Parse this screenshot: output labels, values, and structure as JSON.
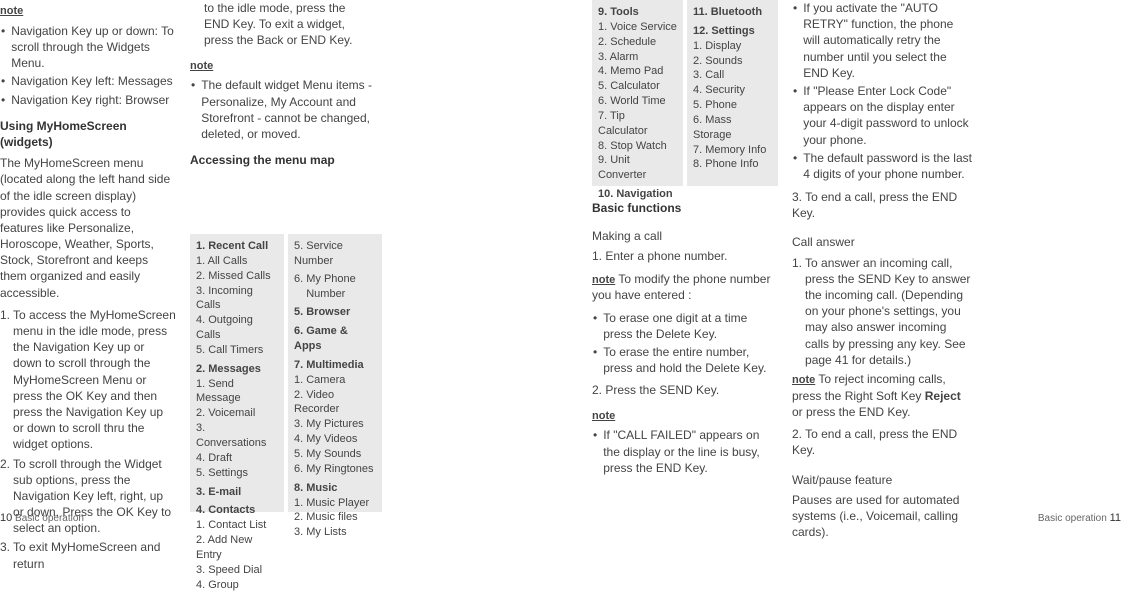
{
  "col1": {
    "note": "note",
    "b1": "Navigation Key up or down: To scroll through the Widgets Menu.",
    "b2": "Navigation Key left: Messages",
    "b3": "Navigation Key right: Browser",
    "h1": "Using MyHomeScreen (widgets)",
    "p1": "The MyHomeScreen menu (located along the left hand side of the idle screen display) provides quick access to features like Personalize, Horoscope, Weather, Sports, Stock, Storefront and keeps them organized and easily accessible.",
    "n1": "1.",
    "n1t": "To access the MyHomeScreen menu in the idle mode, press the Navigation Key up or down to scroll through the MyHomeScreen Menu or press the OK Key and then press the Navigation Key up or down to scroll thru the widget options.",
    "n2": "2.",
    "n2t": "To scroll through the Widget sub options, press the Navigation Key left, right, up or down. Press the OK Key to select an option.",
    "n3": "3.",
    "n3t": "To exit MyHomeScreen and return",
    "footer_num": "10",
    "footer_text": "Basic operation"
  },
  "col2": {
    "cont": "to the idle mode, press the END Key. To exit a widget, press the Back or END Key.",
    "note": "note",
    "b1": "The default widget Menu items - Personalize, My Account and Storefront - cannot be changed, deleted, or moved.",
    "h1": "Accessing the menu map"
  },
  "menu_left": {
    "t1": "1. Recent Call",
    "i1_1": "1.   All Calls",
    "i1_2": "2. Missed Calls",
    "i1_3": "3. Incoming Calls",
    "i1_4": "4. Outgoing Calls",
    "i1_5": "5. Call Timers",
    "t2": "2. Messages",
    "i2_1": "1.   Send Message",
    "i2_2": "2. Voicemail",
    "i2_3": "3. Conversations",
    "i2_4": "4. Draft",
    "i2_5": "5.   Settings",
    "t3": "3. E-mail",
    "t4": "4. Contacts",
    "i4_1": "1.   Contact List",
    "i4_2": "2. Add New Entry",
    "i4_3": "3. Speed Dial",
    "i4_4": "4. Group"
  },
  "menu_right": {
    "i5": "5. Service Number",
    "i6": "6. My Phone Number",
    "t5": "5. Browser",
    "t6": "6. Game & Apps",
    "t7": "7. Multimedia",
    "i7_1": "1.   Camera",
    "i7_2": "2. Video Recorder",
    "i7_3": "3. My Pictures",
    "i7_4": "4. My Videos",
    "i7_5": "5. My Sounds",
    "i7_6": "6. My Ringtones",
    "t8": "8. Music",
    "i8_1": "1.   Music Player",
    "i8_2": "2. Music files",
    "i8_3": "3. My Lists"
  },
  "menu2_left": {
    "t9": "9. Tools",
    "i9_1": "1.   Voice Service",
    "i9_2": "2. Schedule",
    "i9_3": "3. Alarm",
    "i9_4": "4. Memo Pad",
    "i9_5": "5. Calculator",
    "i9_6": "6. World Time",
    "i9_7": "7.   Tip Calculator",
    "i9_8": "8. Stop Watch",
    "i9_9": "9. Unit Converter",
    "t10": "10. Navigation"
  },
  "menu2_right": {
    "t11": "11. Bluetooth",
    "t12": "12. Settings",
    "i12_1": "1.   Display",
    "i12_2": "2. Sounds",
    "i12_3": "3. Call",
    "i12_4": "4. Security",
    "i12_5": "5. Phone",
    "i12_6": "6. Mass Storage",
    "i12_7": "7.   Memory Info",
    "i12_8": "8. Phone Info"
  },
  "col5": {
    "h1": "Basic functions",
    "sh1": "Making a call",
    "p1": "1. Enter a phone number.",
    "note_inline": "note",
    "p2": " To modify the phone number you have entered :",
    "b1": "To erase one digit at a time press the Delete Key.",
    "b2": "To erase the entire number, press and hold the Delete Key.",
    "p3": "2. Press the SEND Key.",
    "note": "note",
    "b3": "If \"CALL FAILED\" appears on the display or the line is busy, press the END Key."
  },
  "col6": {
    "b1": "If you activate the \"AUTO RETRY\" function, the phone will automatically retry the number until you select the END Key.",
    "b2": "If \"Please Enter Lock Code\" appears on the display enter your 4-digit password to unlock your phone.",
    "b3": "The default password is the last 4 digits of your phone number.",
    "p1": "3. To end a call, press the END Key.",
    "sh1": "Call answer",
    "n1": "1.",
    "n1t": "To answer an incoming call, press the SEND Key to answer the incoming call. (Depending on your phone's settings, you may also answer incoming calls by pressing any key. See page 41 for details.)",
    "note_inline": "note",
    "p2_a": " To reject incoming calls, press the Right Soft Key ",
    "p2_b": "Reject",
    "p2_c": " or press the END Key.",
    "p3": "2. To end a call, press the END Key.",
    "sh2": "Wait/pause feature",
    "p4": "Pauses are used for automated systems (i.e., Voicemail, calling cards).",
    "footer_text": "Basic operation",
    "footer_num": "11"
  }
}
